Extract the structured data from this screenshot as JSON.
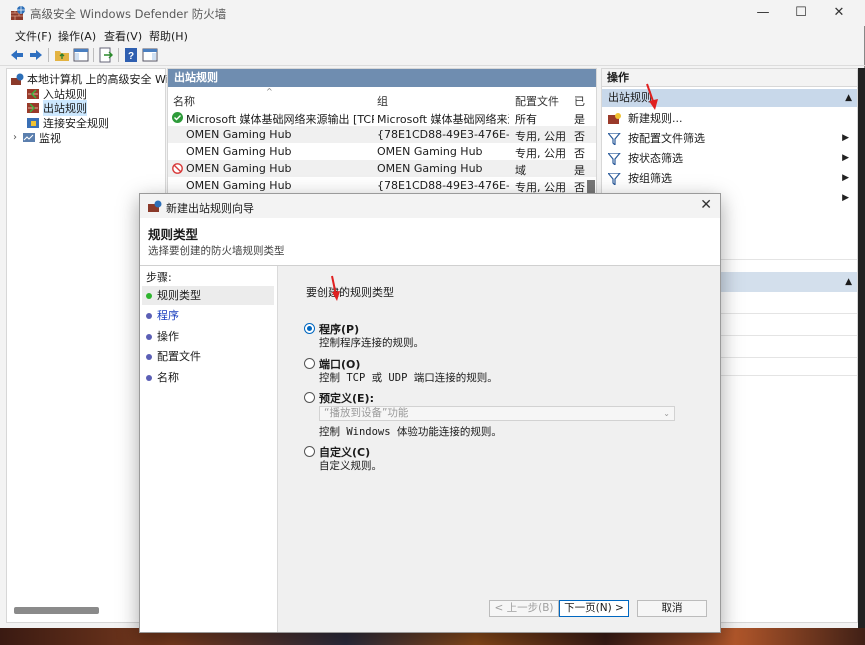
{
  "window": {
    "title": "高级安全 Windows Defender 防火墙",
    "minimize": "—",
    "maximize": "☐",
    "close": "✕"
  },
  "menu": [
    "文件(F)",
    "操作(A)",
    "查看(V)",
    "帮助(H)"
  ],
  "tree": {
    "root": "本地计算机 上的高级安全 Windo",
    "items": [
      "入站规则",
      "出站规则",
      "连接安全规则",
      "监视"
    ],
    "expand": "›"
  },
  "list": {
    "header": "出站规则",
    "sort_indicator": "^",
    "columns": [
      "名称",
      "组",
      "配置文件",
      "已"
    ],
    "rows": [
      {
        "name": "Microsoft 媒体基础网络来源输出 [TCP A...",
        "group": "Microsoft 媒体基础网络来源",
        "profile": "所有",
        "enabled": "是",
        "status": "allow"
      },
      {
        "name": "OMEN Gaming Hub",
        "group": "{78E1CD88-49E3-476E-B9...",
        "profile": "专用, 公用",
        "enabled": "否",
        "status": "none"
      },
      {
        "name": "OMEN Gaming Hub",
        "group": "OMEN Gaming Hub",
        "profile": "专用, 公用",
        "enabled": "否",
        "status": "none"
      },
      {
        "name": "OMEN Gaming Hub",
        "group": "OMEN Gaming Hub",
        "profile": "域",
        "enabled": "是",
        "status": "block"
      },
      {
        "name": "OMEN Gaming Hub",
        "group": "{78E1CD88-49E3-476E-B9...",
        "profile": "专用, 公用",
        "enabled": "否",
        "status": "none"
      }
    ]
  },
  "actions": {
    "header": "操作",
    "section": "出站规则",
    "collapse": "▲",
    "submenu_arrow": "▶",
    "items": [
      "新建规则...",
      "按配置文件筛选",
      "按状态筛选",
      "按组筛选"
    ]
  },
  "dialog": {
    "title": "新建出站规则向导",
    "close": "✕",
    "heading": "规则类型",
    "subheading": "选择要创建的防火墙规则类型",
    "steps_title": "步骤:",
    "steps": [
      "规则类型",
      "程序",
      "操作",
      "配置文件",
      "名称"
    ],
    "prompt": "要创建的规则类型",
    "options": [
      {
        "title": "程序(P)",
        "desc": "控制程序连接的规则。"
      },
      {
        "title": "端口(O)",
        "desc": "控制 TCP 或 UDP 端口连接的规则。"
      },
      {
        "title": "预定义(E):",
        "desc": "控制 Windows 体验功能连接的规则。"
      },
      {
        "title": "自定义(C)",
        "desc": "自定义规则。"
      }
    ],
    "predefined_value": "“播放到设备”功能",
    "combo_arrow": "⌄",
    "buttons": {
      "back": "< 上一步(B)",
      "next": "下一页(N) >",
      "cancel": "取消"
    }
  },
  "colors": {
    "pane_header": "#6f8db0",
    "selected": "#cce8ff",
    "accent": "#0067c0",
    "annotation_arrow": "#e02020"
  }
}
